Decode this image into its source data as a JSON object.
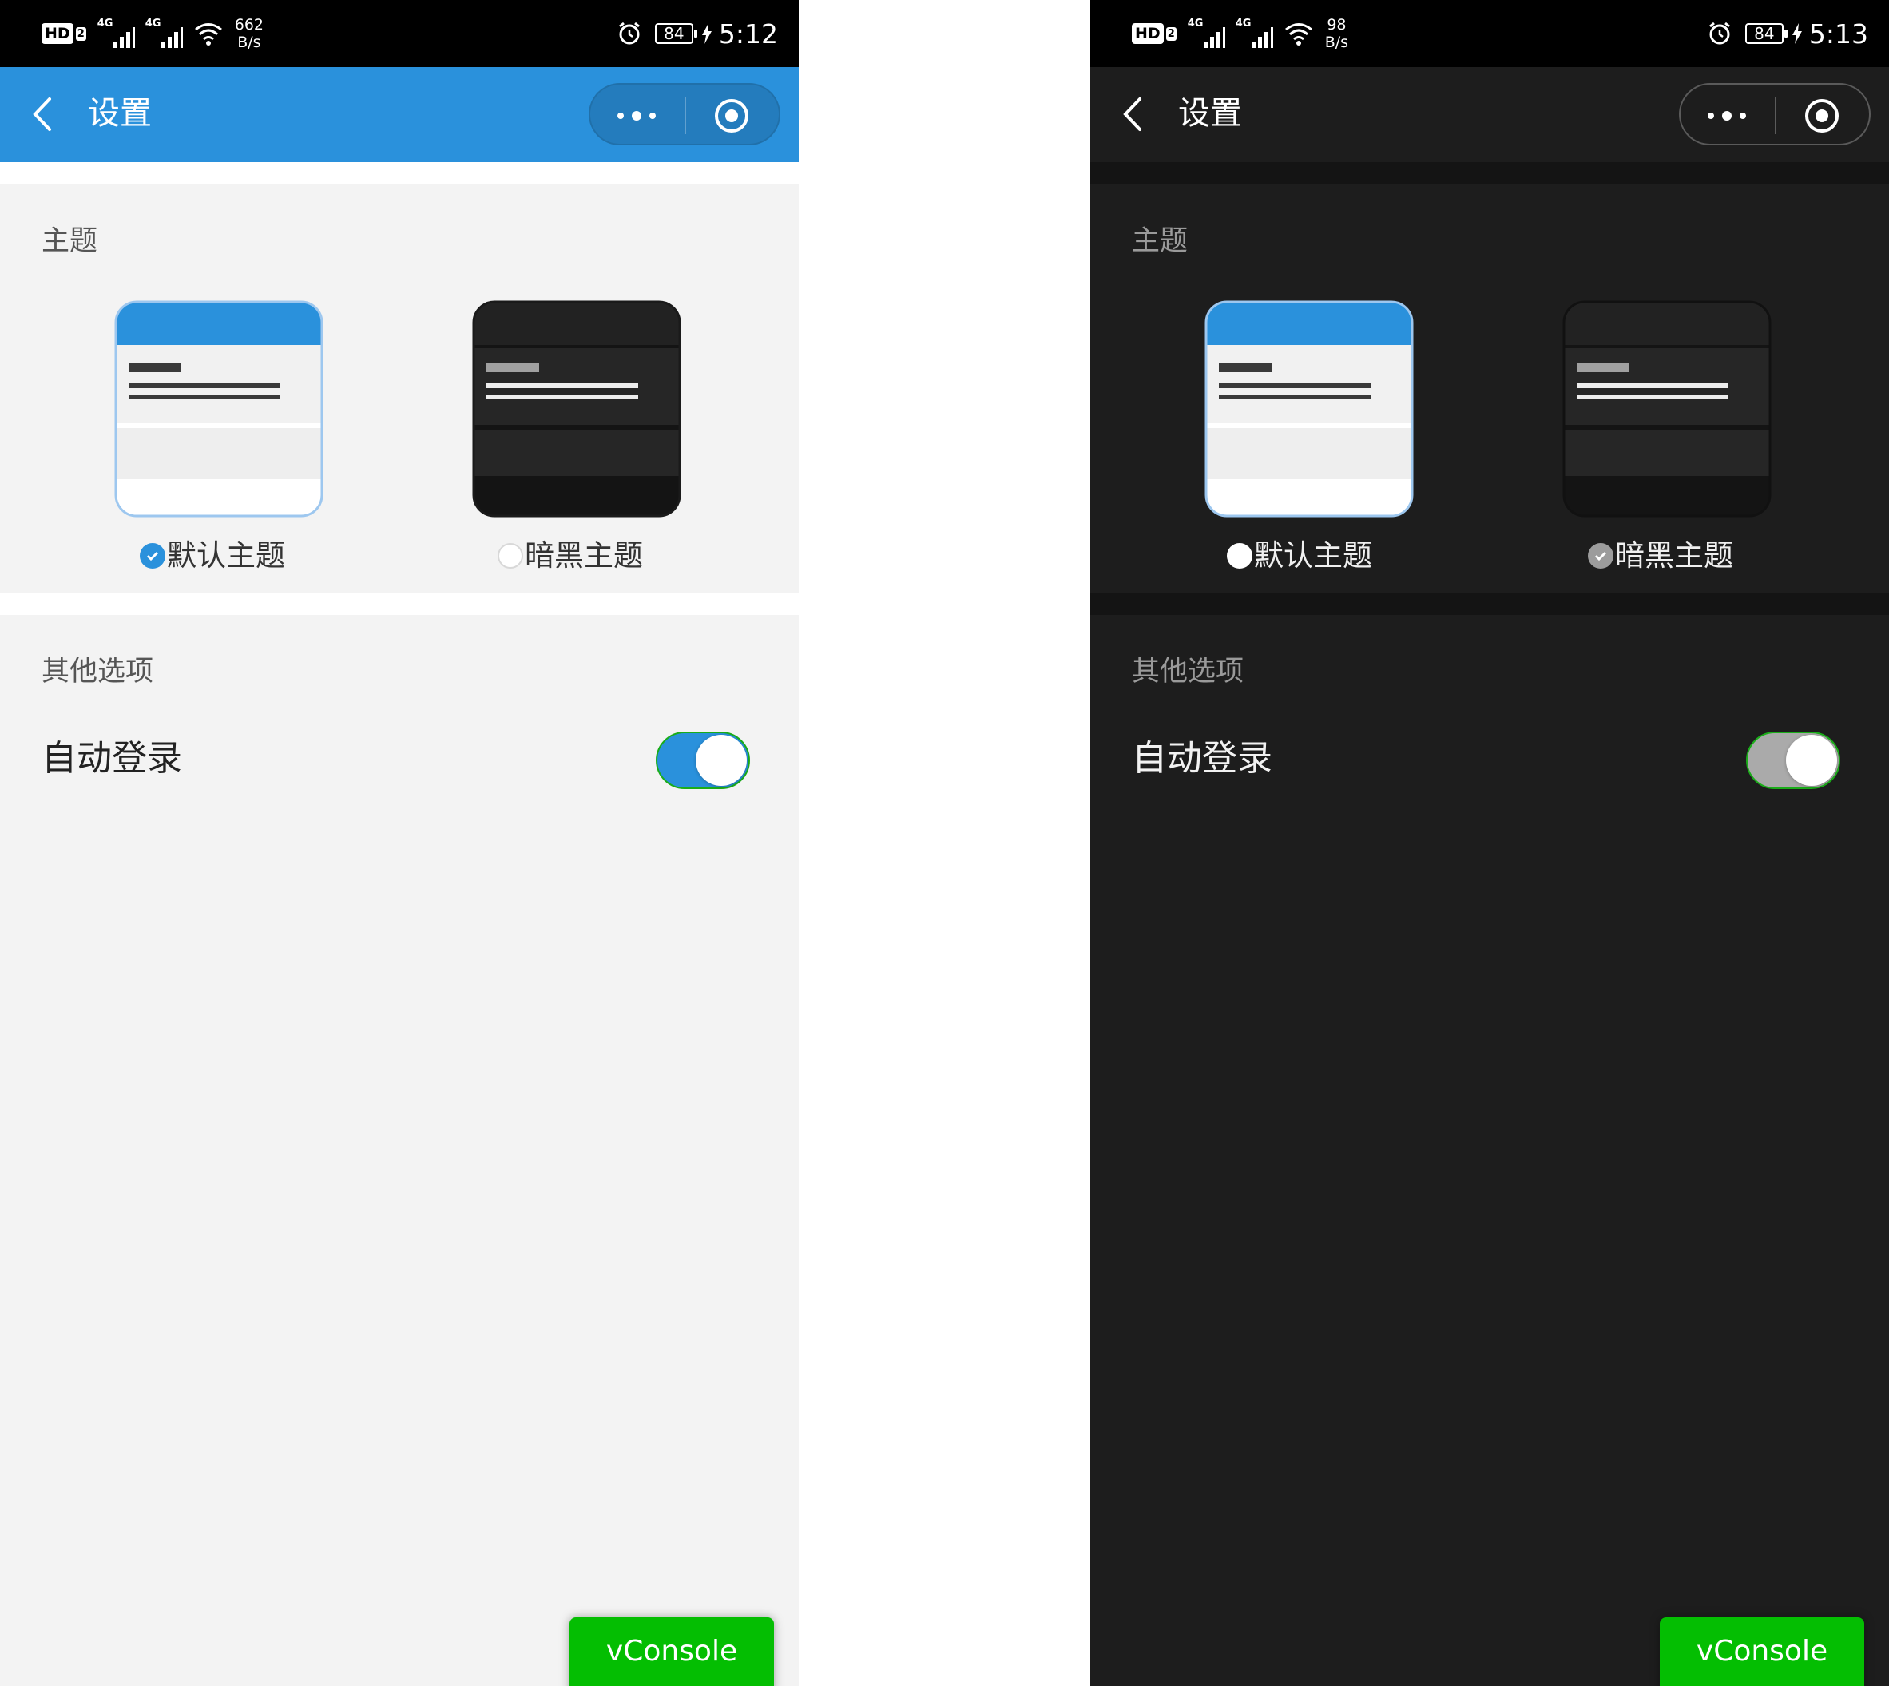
{
  "screens": [
    {
      "theme": "light",
      "status": {
        "hd": "HD",
        "sim": "2",
        "net1": "4G",
        "net2": "4G",
        "speed_value": "662",
        "speed_unit": "B/s",
        "battery": "84",
        "time": "5:12"
      },
      "nav": {
        "title": "设置"
      },
      "theme_section": {
        "title": "主题",
        "default_label": "默认主题",
        "dark_label": "暗黑主题",
        "selected": "default"
      },
      "other_section": {
        "title": "其他选项",
        "auto_login_label": "自动登录",
        "auto_login_on": true
      },
      "vconsole_label": "vConsole"
    },
    {
      "theme": "dark",
      "status": {
        "hd": "HD",
        "sim": "2",
        "net1": "4G",
        "net2": "4G",
        "speed_value": "98",
        "speed_unit": "B/s",
        "battery": "84",
        "time": "5:13"
      },
      "nav": {
        "title": "设置"
      },
      "theme_section": {
        "title": "主题",
        "default_label": "默认主题",
        "dark_label": "暗黑主题",
        "selected": "dark"
      },
      "other_section": {
        "title": "其他选项",
        "auto_login_label": "自动登录",
        "auto_login_on": true
      },
      "vconsole_label": "vConsole"
    }
  ],
  "colors": {
    "primary_blue": "#2a91dc",
    "light_background": "#f3f3f3",
    "dark_background": "#1d1d1d",
    "switch_border_green": "#1aad19",
    "vconsole_green": "#04be02"
  },
  "icons": [
    "back-chevron-icon",
    "more-dots-icon",
    "close-target-icon",
    "alarm-icon",
    "wifi-icon",
    "signal-icon",
    "battery-icon",
    "charging-bolt-icon",
    "check-icon"
  ]
}
